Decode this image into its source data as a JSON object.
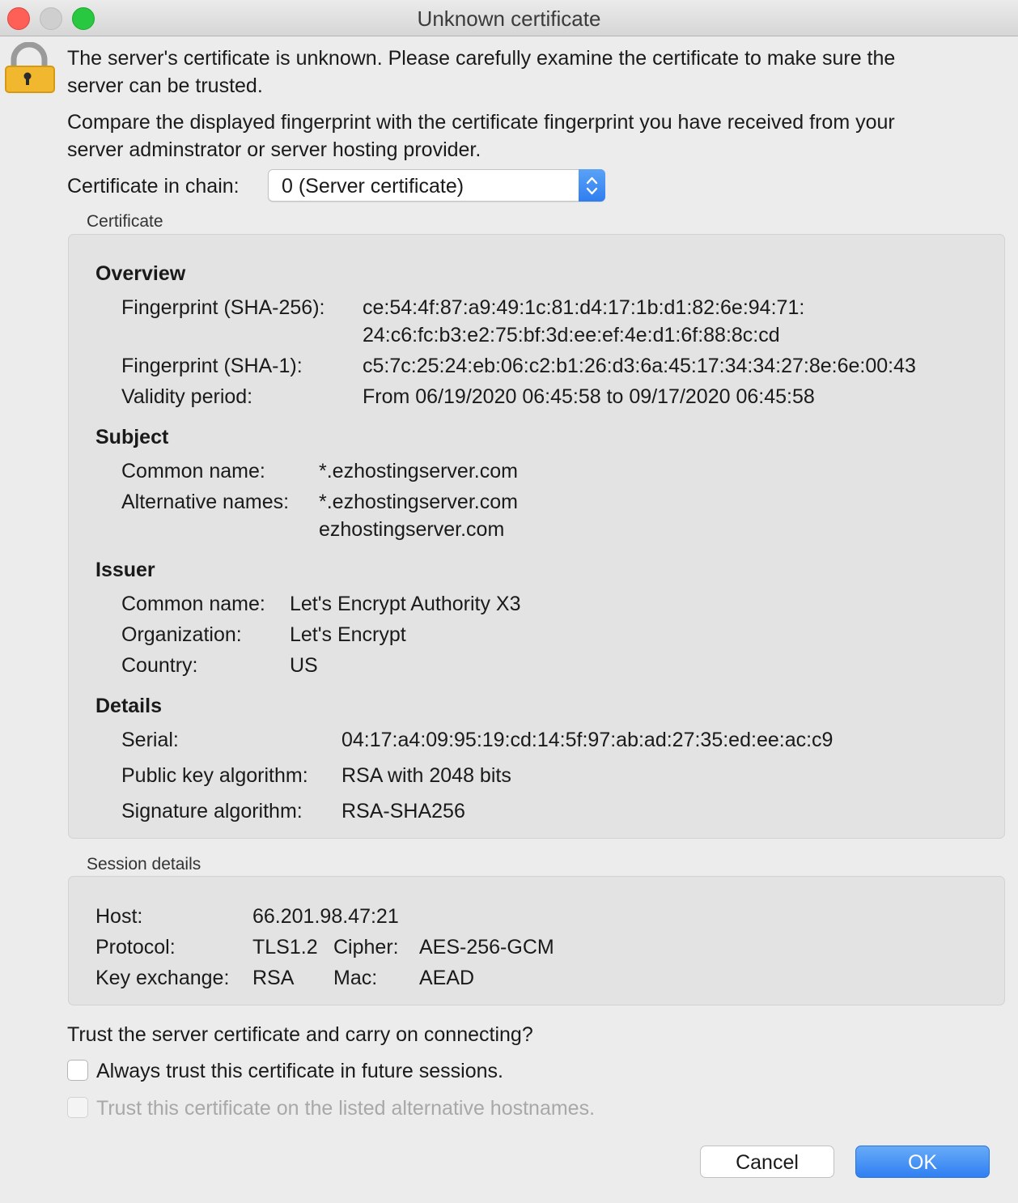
{
  "window": {
    "title": "Unknown certificate"
  },
  "intro": {
    "line1a": "The server's certificate is unknown. Please carefully examine the certificate to make sure the",
    "line1b": "server can be trusted.",
    "line2a": "Compare the displayed fingerprint with the certificate fingerprint you have received from your",
    "line2b": "server adminstrator or server hosting provider."
  },
  "chain": {
    "label": "Certificate in chain:",
    "selected": "0 (Server certificate)"
  },
  "certificate": {
    "group_label": "Certificate",
    "overview": {
      "heading": "Overview",
      "sha256_label": "Fingerprint (SHA-256):",
      "sha256_line1": "ce:54:4f:87:a9:49:1c:81:d4:17:1b:d1:82:6e:94:71:",
      "sha256_line2": "24:c6:fc:b3:e2:75:bf:3d:ee:ef:4e:d1:6f:88:8c:cd",
      "sha1_label": "Fingerprint (SHA-1):",
      "sha1_value": "c5:7c:25:24:eb:06:c2:b1:26:d3:6a:45:17:34:34:27:8e:6e:00:43",
      "validity_label": "Validity period:",
      "validity_value": "From 06/19/2020 06:45:58 to 09/17/2020 06:45:58"
    },
    "subject": {
      "heading": "Subject",
      "cn_label": "Common name:",
      "cn_value": "*.ezhostingserver.com",
      "alt_label": "Alternative names:",
      "alt_values": [
        "*.ezhostingserver.com",
        "ezhostingserver.com"
      ]
    },
    "issuer": {
      "heading": "Issuer",
      "cn_label": "Common name:",
      "cn_value": "Let's Encrypt Authority X3",
      "org_label": "Organization:",
      "org_value": "Let's Encrypt",
      "country_label": "Country:",
      "country_value": "US"
    },
    "details": {
      "heading": "Details",
      "serial_label": "Serial:",
      "serial_value": "04:17:a4:09:95:19:cd:14:5f:97:ab:ad:27:35:ed:ee:ac:c9",
      "pk_label": "Public key algorithm:",
      "pk_value": "RSA with 2048 bits",
      "sig_label": "Signature algorithm:",
      "sig_value": "RSA-SHA256"
    }
  },
  "session": {
    "group_label": "Session details",
    "host_label": "Host:",
    "host_value": "66.201.98.47:21",
    "protocol_label": "Protocol:",
    "protocol_value": "TLS1.2",
    "cipher_label": "Cipher:",
    "cipher_value": "AES-256-GCM",
    "kex_label": "Key exchange:",
    "kex_value": "RSA",
    "mac_label": "Mac:",
    "mac_value": "AEAD"
  },
  "trust": {
    "question": "Trust the server certificate and carry on connecting?",
    "always_label": "Always trust this certificate in future sessions.",
    "always_checked": false,
    "alt_label": "Trust this certificate on the listed alternative hostnames.",
    "alt_checked": false,
    "alt_enabled": false
  },
  "buttons": {
    "cancel": "Cancel",
    "ok": "OK"
  },
  "icons": {
    "lock": "lock-icon",
    "select_arrows": "chevron-updown-icon"
  }
}
